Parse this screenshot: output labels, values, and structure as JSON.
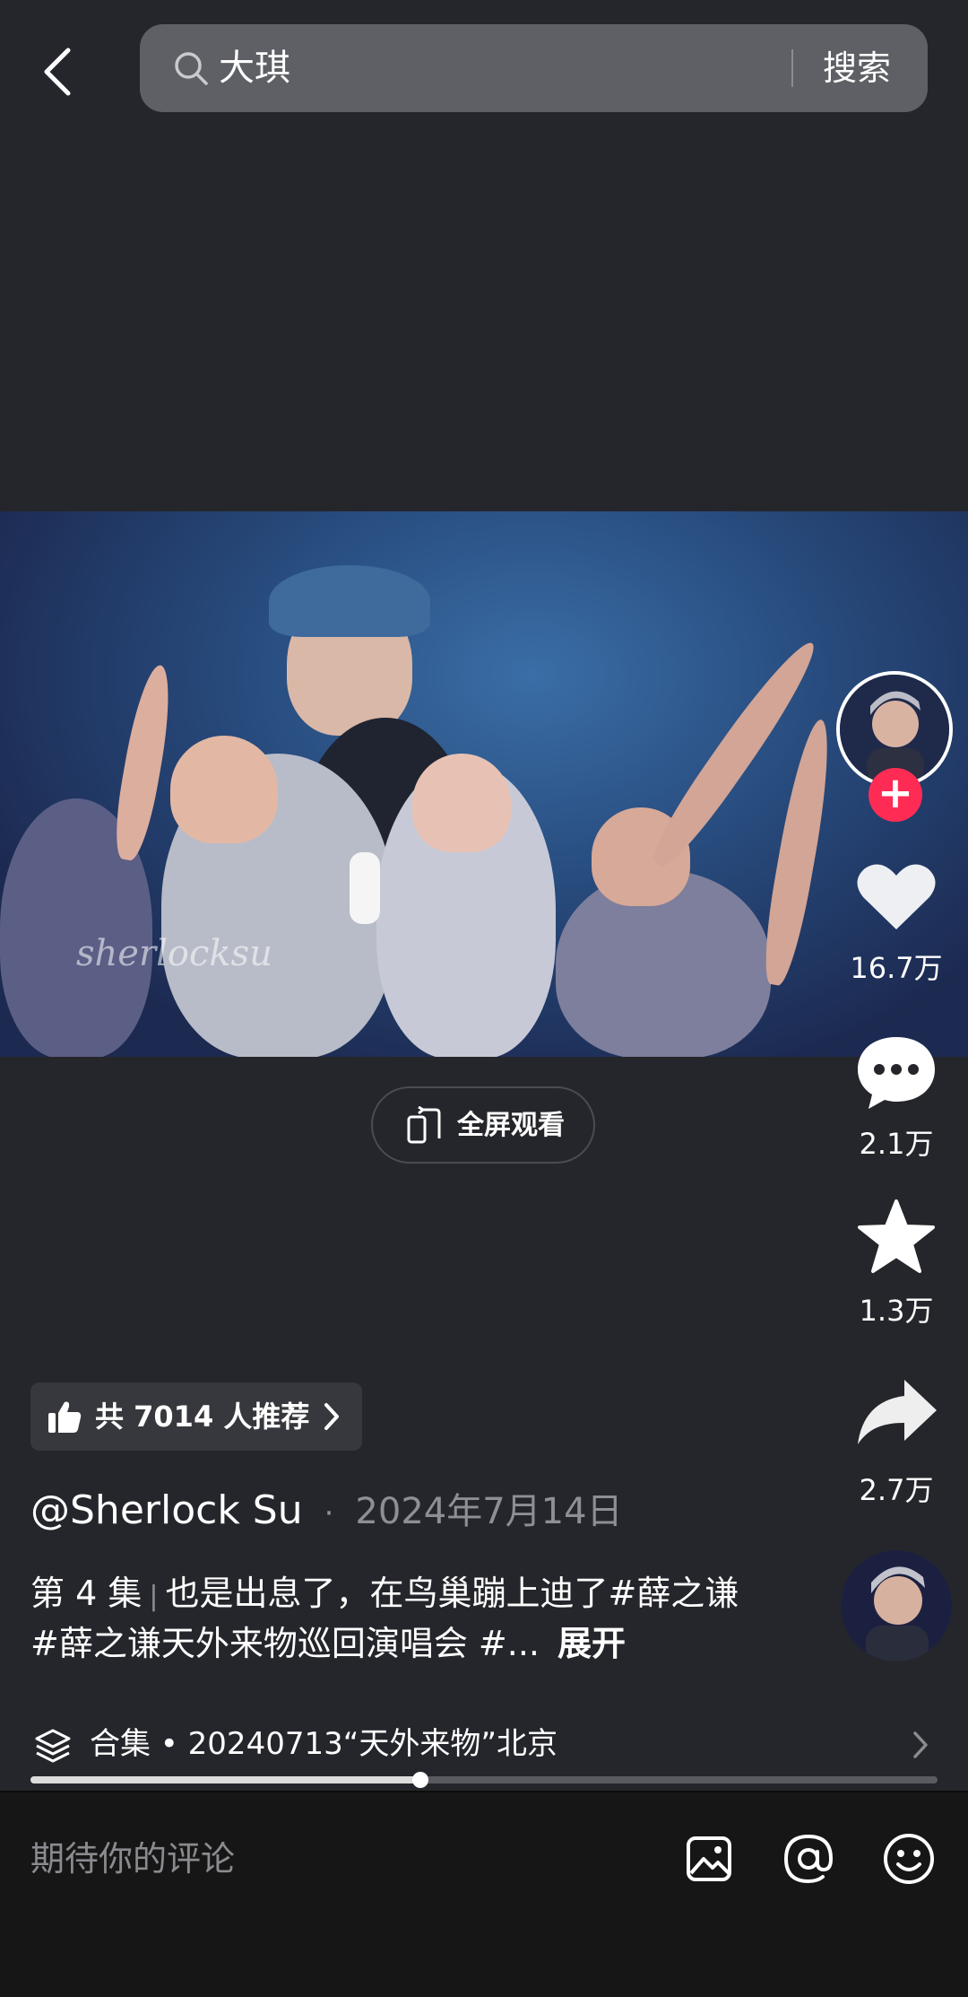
{
  "search": {
    "query": "大琪",
    "button_label": "搜索",
    "icon": "search-icon"
  },
  "actions": {
    "fullscreen_label": "全屏观看",
    "likes": "16.7万",
    "comments": "2.1万",
    "favorites": "1.3万",
    "shares": "2.7万"
  },
  "video": {
    "watermark": "sherlocksu"
  },
  "recommend": {
    "label": "共 7014 人推荐"
  },
  "post": {
    "author": "@Sherlock Su",
    "date_separator": "·",
    "date": "2024年7月14日",
    "episode": "第 4 集",
    "episode_separator": "|",
    "caption": "也是出息了，在鸟巢蹦上迪了#薛之谦 #薛之谦天外来物巡回演唱会 #...",
    "expand_label": "展开"
  },
  "collection": {
    "label": "合集 • 20240713“天外来物”北京"
  },
  "playback": {
    "progress_fraction": 0.43
  },
  "comment_bar": {
    "placeholder": "期待你的评论"
  },
  "colors": {
    "background": "#25262b",
    "follow_red": "#fe2c55",
    "bottom_bar": "#161616"
  }
}
